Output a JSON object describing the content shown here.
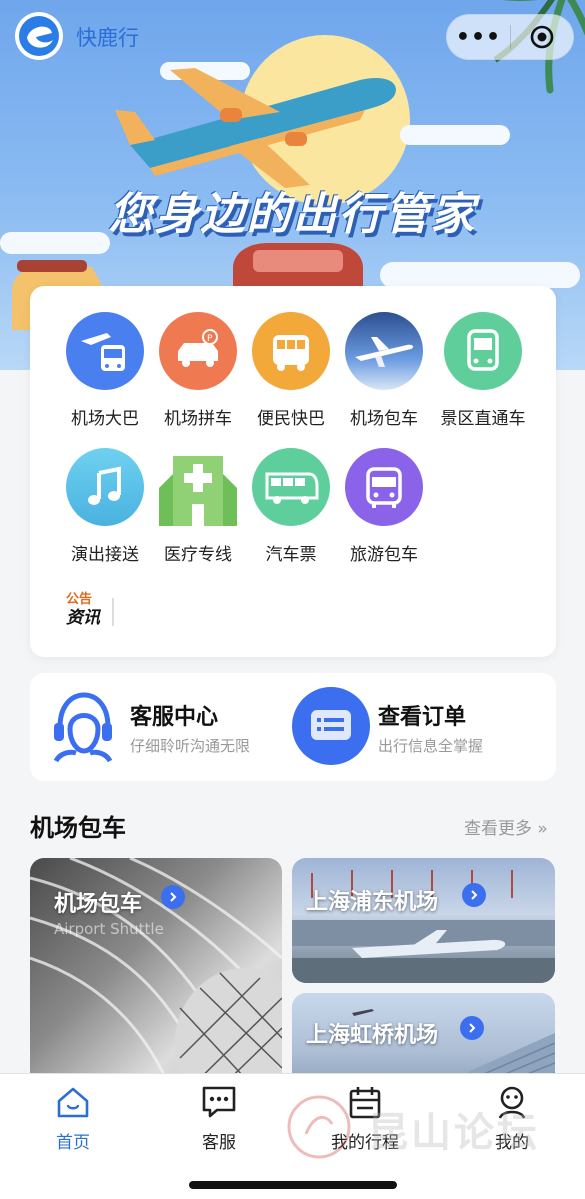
{
  "app": {
    "name": "快鹿行",
    "logo_icon": "kuailu-logo-icon",
    "more_icon": "more-dots-icon",
    "close_icon": "mini-program-target-icon"
  },
  "banner": {
    "slogan": "您身边的出行管家"
  },
  "services": {
    "items": [
      {
        "label": "机场大巴",
        "icon": "airport-bus-icon",
        "color": "#4a7ff0"
      },
      {
        "label": "机场拼车",
        "icon": "carpool-icon",
        "color": "#ef7a52"
      },
      {
        "label": "便民快巴",
        "icon": "express-bus-icon",
        "color": "#f3a83a"
      },
      {
        "label": "机场包车",
        "icon": "airplane-charter-icon",
        "color": "#3a5fa8"
      },
      {
        "label": "景区直通车",
        "icon": "scenic-bus-icon",
        "color": "#5fce9a"
      },
      {
        "label": "演出接送",
        "icon": "music-note-icon",
        "color": "#5cc6e8"
      },
      {
        "label": "医疗专线",
        "icon": "hospital-icon",
        "color": "#7dc868"
      },
      {
        "label": "汽车票",
        "icon": "coach-ticket-icon",
        "color": "#5ecf9c"
      },
      {
        "label": "旅游包车",
        "icon": "tour-bus-icon",
        "color": "#8b63e8"
      }
    ],
    "notice": {
      "line1": "公告",
      "line2": "资讯"
    }
  },
  "help": {
    "service": {
      "title": "客服中心",
      "subtitle": "仔细聆听沟通无限",
      "icon": "customer-service-icon"
    },
    "orders": {
      "title": "查看订单",
      "subtitle": "出行信息全掌握",
      "icon": "order-list-icon"
    }
  },
  "section": {
    "title": "机场包车",
    "more": "查看更多 »",
    "tiles": [
      {
        "title": "机场包车",
        "subtitle": "Airport Shuttle"
      },
      {
        "title": "上海浦东机场"
      },
      {
        "title": "上海虹桥机场"
      }
    ]
  },
  "tabbar": {
    "tabs": [
      {
        "label": "首页",
        "icon": "home-icon",
        "active": true
      },
      {
        "label": "客服",
        "icon": "chat-bubble-icon"
      },
      {
        "label": "我的行程",
        "icon": "calendar-icon"
      },
      {
        "label": "我的",
        "icon": "profile-icon"
      }
    ]
  },
  "watermark": {
    "text": "昆山论坛"
  },
  "colors": {
    "accent": "#2a6fd6",
    "button_blue": "#3b6ff0"
  }
}
